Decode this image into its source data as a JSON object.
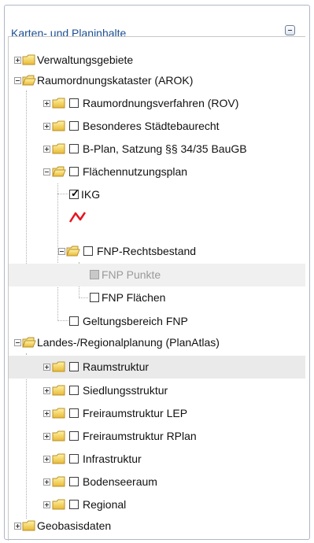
{
  "panel": {
    "title": "Karten- und Planinhalte"
  },
  "tree": {
    "verwaltungsgebiete": "Verwaltungsgebiete",
    "arok": "Raumordnungskataster (AROK)",
    "rov": "Raumordnungsverfahren (ROV)",
    "staedtebau": "Besonderes Städtebaurecht",
    "bplan": "B-Plan, Satzung §§ 34/35 BauGB",
    "fnp": "Flächennutzungsplan",
    "ikg": "IKG",
    "fnp_rechtsbestand": "FNP-Rechtsbestand",
    "fnp_punkte": "FNP Punkte",
    "fnp_flaechen": "FNP Flächen",
    "geltungsbereich": "Geltungsbereich FNP",
    "landes": "Landes-/Regionalplanung (PlanAtlas)",
    "raumstruktur": "Raumstruktur",
    "siedlung": "Siedlungsstruktur",
    "freiraum_lep": "Freiraumstruktur LEP",
    "freiraum_rplan": "Freiraumstruktur RPlan",
    "infrastruktur": "Infrastruktur",
    "bodensee": "Bodenseeraum",
    "regional": "Regional",
    "geobasis": "Geobasisdaten"
  },
  "colors": {
    "title": "#1c4f93",
    "folder": "#f5d54a",
    "legend_line": "#e8141e"
  }
}
